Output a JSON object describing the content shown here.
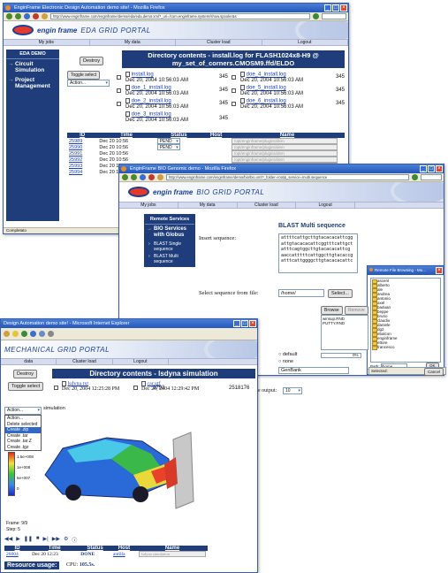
{
  "win1": {
    "title": "EnginFrame Electronic Design Automation demo site! - Mozilla Firefox",
    "url": "http://www.enginframe.com/enginframe/demo/eda/eda.demo.xml?_uri=/com.enginframe.system/show.spooler&s",
    "portal_name": "EDA GRID PORTAL",
    "menu": [
      "My jobs",
      "My data",
      "Cluster load",
      "Logout"
    ],
    "sidebar_header": "EDA DEMO",
    "sidebar_items": [
      "Circuit Simulation",
      "Project Management"
    ],
    "destroy": "Destroy",
    "dir_title": "Directory contents - install.log for FLASH1024x8-H9 @ my_set_of_corners.CMOSM9.ffd/ELDO",
    "toggle": "Toggle select",
    "action": "Action...",
    "files": [
      {
        "name": "install.log",
        "date": "Dec 20, 2004 10:56:03 AM",
        "size": "345"
      },
      {
        "name": "doe_4_install.log",
        "date": "Dec 20, 2004 10:56:03 AM",
        "size": "345"
      },
      {
        "name": "doe_1_install.log",
        "date": "Dec 20, 2004 10:56:03 AM",
        "size": "345"
      },
      {
        "name": "doe_5_install.log",
        "date": "Dec 20, 2004 10:56:03 AM",
        "size": "345"
      },
      {
        "name": "doe_2_install.log",
        "date": "Dec 20, 2004 10:56:03 AM",
        "size": "345"
      },
      {
        "name": "doe_6_install.log",
        "date": "Dec 20, 2004 10:56:03 AM",
        "size": "345"
      },
      {
        "name": "doe_3_install.log",
        "date": "Dec 20, 2004 10:56:03 AM",
        "size": "345"
      }
    ],
    "jobs_headers": [
      "ID",
      "Time",
      "Status",
      "Host",
      "Name"
    ],
    "jobs": [
      {
        "id": "25989",
        "time": "Dec 20 10:56",
        "status": "PEND",
        "name": "/opt/enginframe/plugins/dem"
      },
      {
        "id": "25990",
        "time": "Dec 20 10:56",
        "status": "PEND",
        "name": "/opt/enginframe/plugins/dem"
      },
      {
        "id": "25991",
        "time": "Dec 20 10:56",
        "status": "",
        "name": "/opt/enginframe/plugins/dem"
      },
      {
        "id": "25992",
        "time": "Dec 20 10:56",
        "status": "",
        "name": "/opt/enginframe/plugins/dem"
      },
      {
        "id": "25993",
        "time": "Dec 20 10:56",
        "status": "",
        "name": "/opt/enginframe/plugins/dem"
      },
      {
        "id": "25994",
        "time": "Dec 20 10:56",
        "status": "",
        "name": "/opt/enginframe/plugins/dem"
      }
    ],
    "status": "Completato"
  },
  "win2": {
    "title": "EnginFrame BIO Genomic demo - Mozilla Firefox",
    "url": "http://www.enginframe.com/enginframe/demo/bio/bio.xml?_folder=root&_service=multi.sequence",
    "portal_name": "BIO GRID PORTAL",
    "menu": [
      "My jobs",
      "My data",
      "Cluster load",
      "Logout"
    ],
    "sidebar_header": "Remote Services",
    "sidebar_item": "BIO Services with Globus",
    "sidebar_subs": [
      "BLAST Single sequence",
      "BLAST Multi sequence"
    ],
    "page_title": "BLAST Multi sequence",
    "insert_label": "Insert sequence:",
    "sequence_lines": [
      "attttcattgcttgtacacacattcgg",
      "attgtacacacattcggtttcattgct",
      "atttcagtggcttgtacacacattcg",
      "aaccatttttcattggcttgtacaccg",
      "atttcattggggcttgtacacacattc"
    ],
    "select_label": "Select sequence from file:",
    "path_value": "/home/",
    "select_btn": "Select...",
    "radios": [
      "default",
      "none"
    ],
    "db_value": "GenBank",
    "output_label": "e output:",
    "output_value": "10",
    "popup": {
      "title": "Remote File Browsing - Mo...",
      "browse": "Browse",
      "remove": "Remove",
      "files": [
        "winsup.RND",
        "PUTTY.RND"
      ],
      "percent": "0%",
      "folders": [
        "ascent",
        "alberto",
        "ale",
        "andrea",
        "antonio",
        "axel",
        "baduan",
        "beppe",
        "bruno",
        "claudio",
        "daniele",
        "dg2",
        "ebalcon",
        "enginframe",
        "ettore",
        "francesco"
      ],
      "path_label": "Path:",
      "path_value": "/home",
      "ok": "OK",
      "selected_label": "Selected:",
      "cancel": "Cancel",
      "status": "Completato"
    }
  },
  "win3": {
    "title": "Design Automation demo site! - Microsoft Internet Explorer",
    "portal_name": "MECHANICAL GRID PORTAL",
    "menu": [
      "data",
      "Cluster load",
      "Logout"
    ],
    "destroy": "Destroy",
    "dir_title": "Directory contents - lsdyna simulation",
    "toggle": "Toggle select",
    "files": [
      {
        "name": "lsdyna.txt",
        "date": "Dec 20, 2004 12:25:28 PM",
        "size": "3792"
      },
      {
        "name": "car.vtf",
        "date": "Dec 20, 2004 12:29:42 PM",
        "size": "2518176"
      }
    ],
    "action": "Action...",
    "action_options": [
      "Action...",
      "Delete selected",
      "Create .zip",
      "Create .tar",
      "Create .tar.Z",
      "Create .tgz"
    ],
    "sim_label": "simulation",
    "legend": [
      "1.5e+008",
      "1e+008",
      "5e+007",
      "0"
    ],
    "frame": "Frame: 9/9",
    "step": "Step: 5",
    "jobs_headers": [
      "ID",
      "Time",
      "Status",
      "Host",
      "Name"
    ],
    "job": {
      "id": "26004",
      "time": "Dec 20 12:23",
      "status": "DONE",
      "host": "antilla",
      "name": "lsdyna simulation"
    },
    "resource_label": "Resource usage:",
    "cpu_label": "CPU:",
    "cpu_value": "105.5s."
  }
}
